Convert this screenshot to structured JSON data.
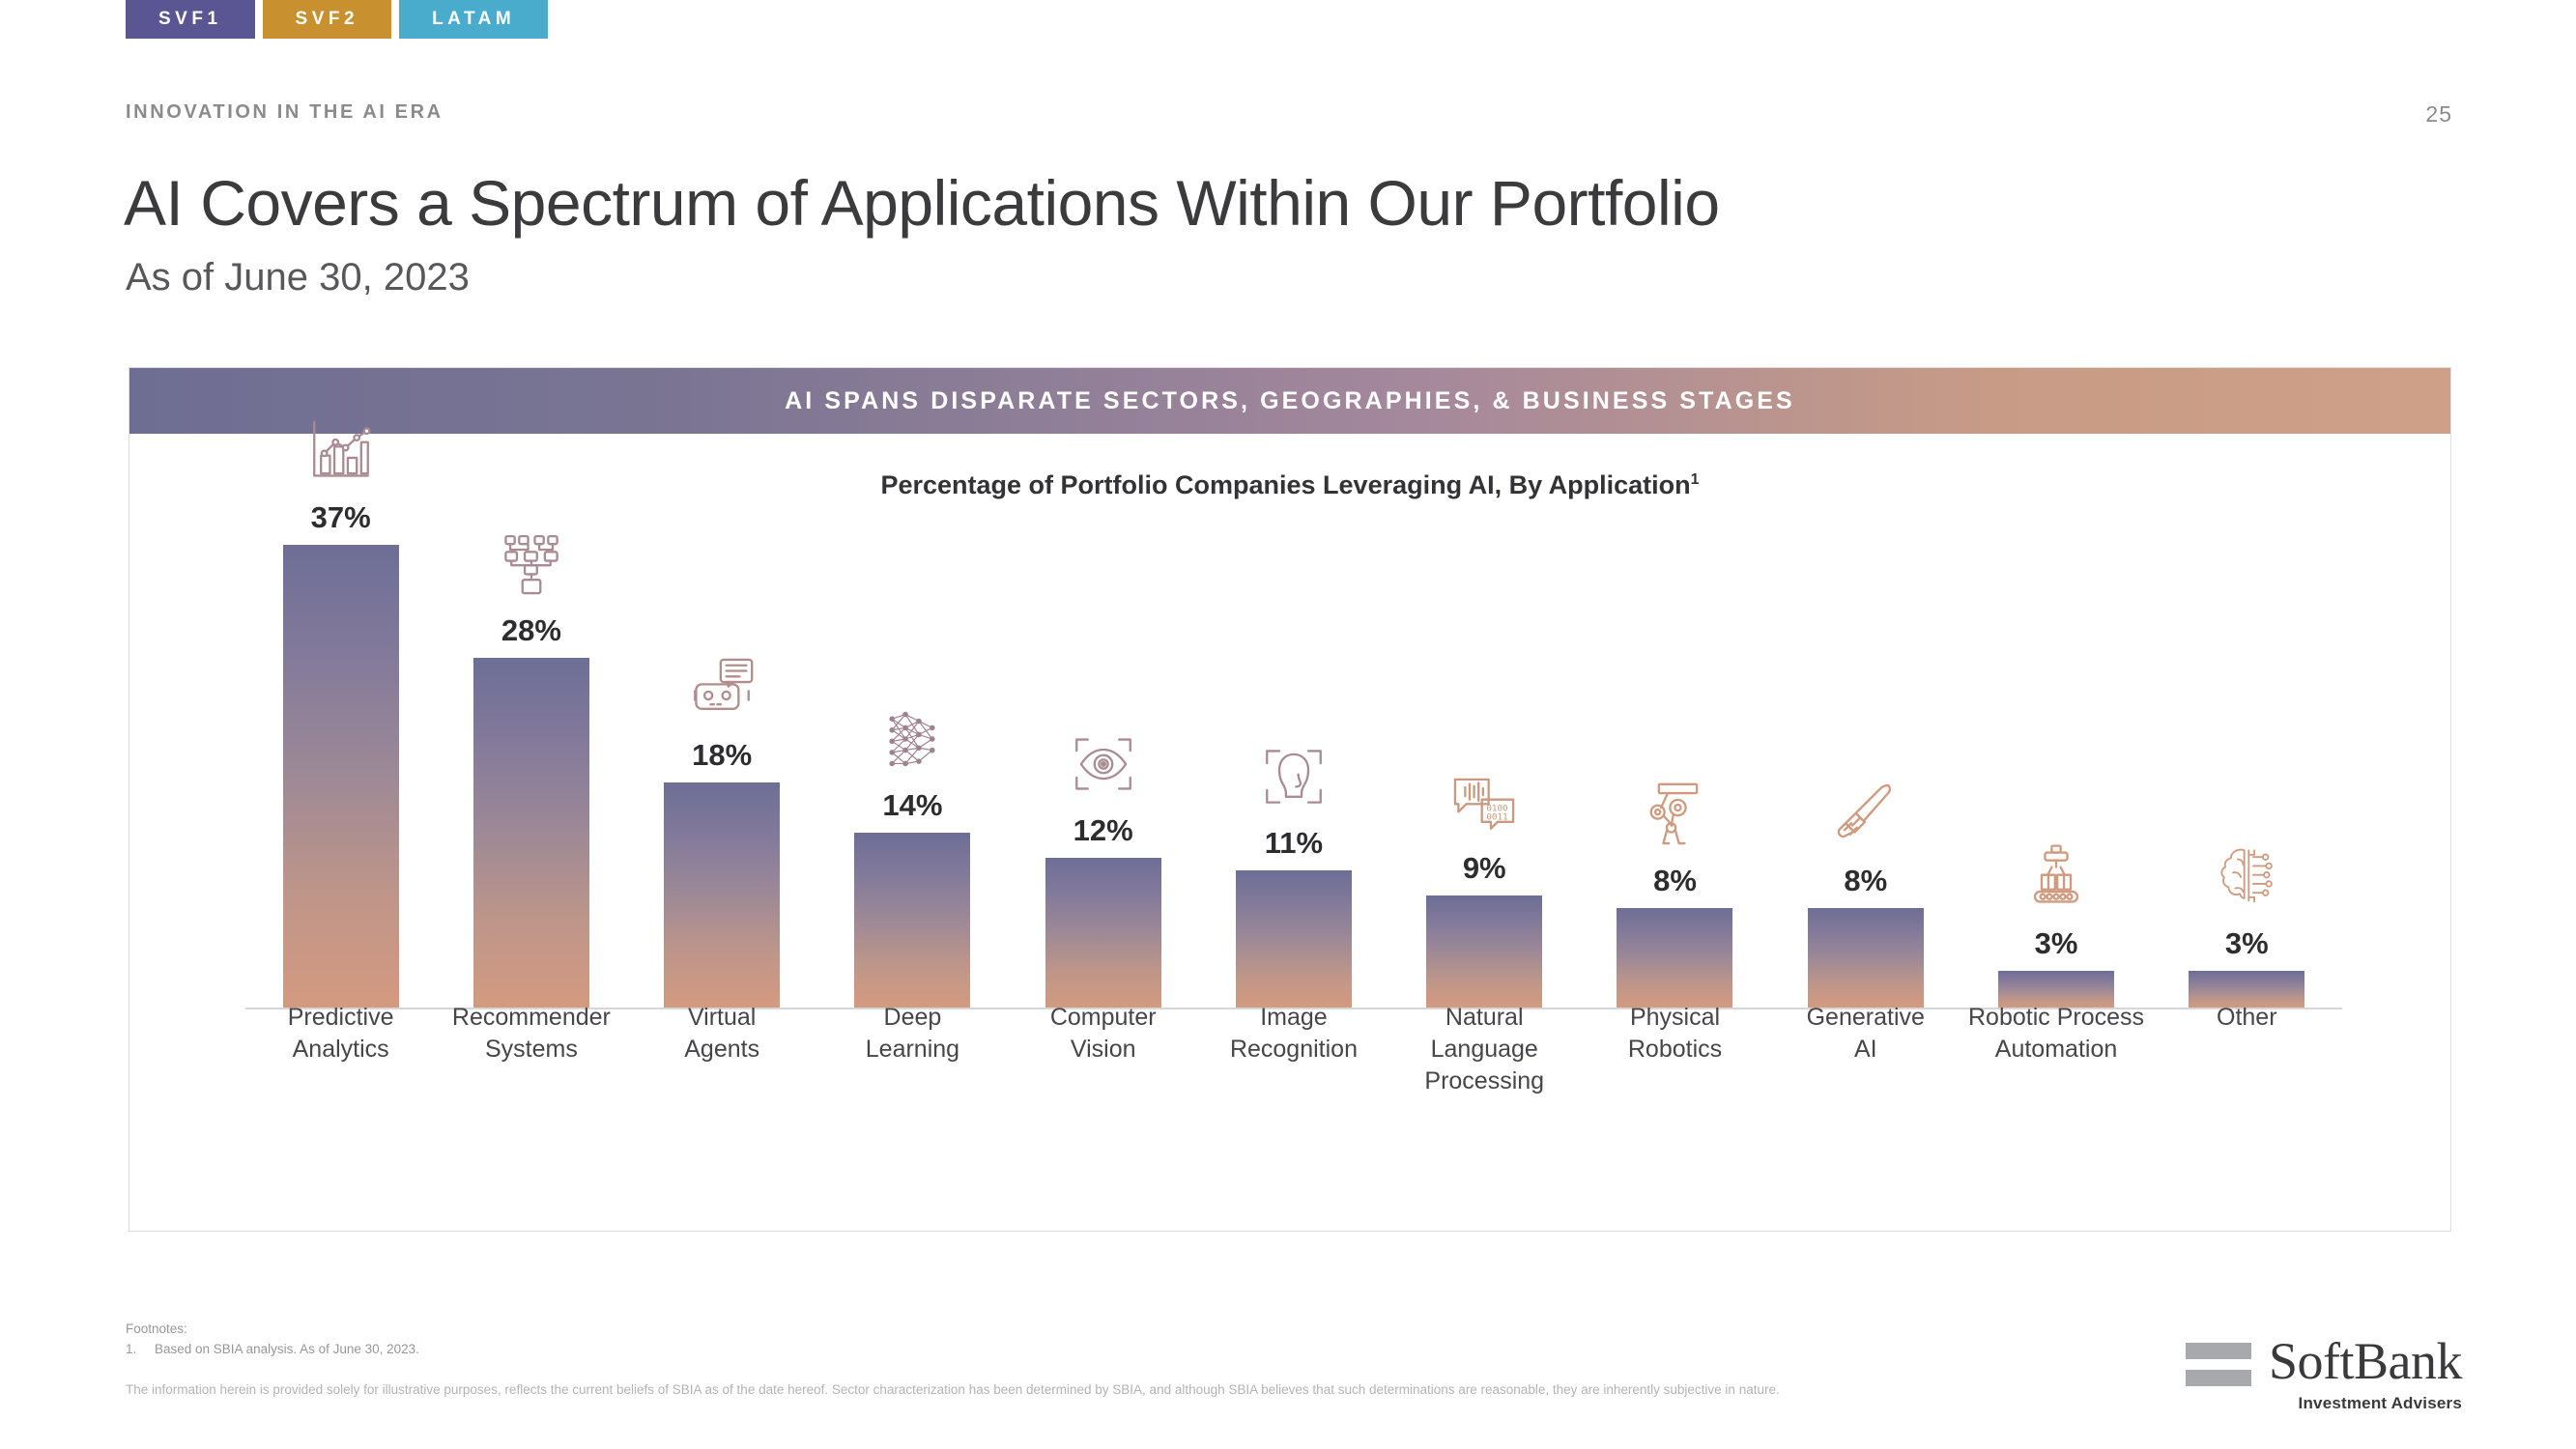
{
  "tabs": [
    {
      "label": "SVF1",
      "color": "#5a5593"
    },
    {
      "label": "SVF2",
      "color": "#c8902e"
    },
    {
      "label": "LATAM",
      "color": "#4aaccd"
    }
  ],
  "header": {
    "eyebrow": "INNOVATION IN THE AI ERA",
    "title": "AI Covers a Spectrum of Applications Within Our Portfolio",
    "subtitle": "As of June 30, 2023",
    "page_number": "25"
  },
  "card": {
    "banner_text": "AI SPANS DISPARATE SECTORS, GEOGRAPHIES, & BUSINESS STAGES",
    "banner_gradient_from": "#6e6e93",
    "banner_gradient_to": "#cfa088",
    "chart_title": "Percentage of Portfolio Companies Leveraging AI, By Application",
    "chart_title_footnote_marker": "1"
  },
  "chart_data": {
    "type": "bar",
    "title": "Percentage of Portfolio Companies Leveraging AI, By Application",
    "xlabel": "",
    "ylabel": "",
    "ylim": [
      0,
      37
    ],
    "grid": false,
    "legend": false,
    "value_suffix": "%",
    "bar_gradient_top": "#6d6e96",
    "bar_gradient_bottom": "#d49a7f",
    "categories": [
      "Predictive Analytics",
      "Recommender Systems",
      "Virtual Agents",
      "Deep Learning",
      "Computer Vision",
      "Image Recognition",
      "Natural Language Processing",
      "Physical Robotics",
      "Generative AI",
      "Robotic Process Automation",
      "Other"
    ],
    "values": [
      37,
      28,
      18,
      14,
      12,
      11,
      9,
      8,
      8,
      3,
      3
    ],
    "points": [
      {
        "category_line1": "Predictive",
        "category_line2": "Analytics",
        "value": 37,
        "label": "37%",
        "icon": "bar-chart-trend-icon"
      },
      {
        "category_line1": "Recommender",
        "category_line2": "Systems",
        "value": 28,
        "label": "28%",
        "icon": "recommendation-tree-icon"
      },
      {
        "category_line1": "Virtual",
        "category_line2": "Agents",
        "value": 18,
        "label": "18%",
        "icon": "chatbot-icon"
      },
      {
        "category_line1": "Deep",
        "category_line2": "Learning",
        "value": 14,
        "label": "14%",
        "icon": "neural-network-icon"
      },
      {
        "category_line1": "Computer",
        "category_line2": "Vision",
        "value": 12,
        "label": "12%",
        "icon": "eye-scan-icon"
      },
      {
        "category_line1": "Image",
        "category_line2": "Recognition",
        "value": 11,
        "label": "11%",
        "icon": "face-scan-icon"
      },
      {
        "category_line1": "Natural Language",
        "category_line2": "Processing",
        "value": 9,
        "label": "9%",
        "icon": "speech-binary-icon"
      },
      {
        "category_line1": "Physical",
        "category_line2": "Robotics",
        "value": 8,
        "label": "8%",
        "icon": "robot-arm-icon"
      },
      {
        "category_line1": "Generative",
        "category_line2": "AI",
        "value": 8,
        "label": "8%",
        "icon": "paintbrush-icon"
      },
      {
        "category_line1": "Robotic Process",
        "category_line2": "Automation",
        "value": 3,
        "label": "3%",
        "icon": "conveyor-robot-icon"
      },
      {
        "category_line1": "Other",
        "category_line2": "",
        "value": 3,
        "label": "3%",
        "icon": "brain-circuit-icon"
      }
    ]
  },
  "footnotes": {
    "heading": "Footnotes:",
    "items": [
      {
        "num": "1.",
        "text": "Based on SBIA analysis. As of June 30, 2023."
      }
    ],
    "disclaimer": "The information herein is provided solely for illustrative purposes, reflects the current beliefs of SBIA as of the date hereof. Sector characterization has been determined by SBIA, and although  SBIA believes that such determinations are reasonable, they are inherently subjective in nature."
  },
  "logo": {
    "name": "SoftBank",
    "sub": "Investment Advisers"
  }
}
